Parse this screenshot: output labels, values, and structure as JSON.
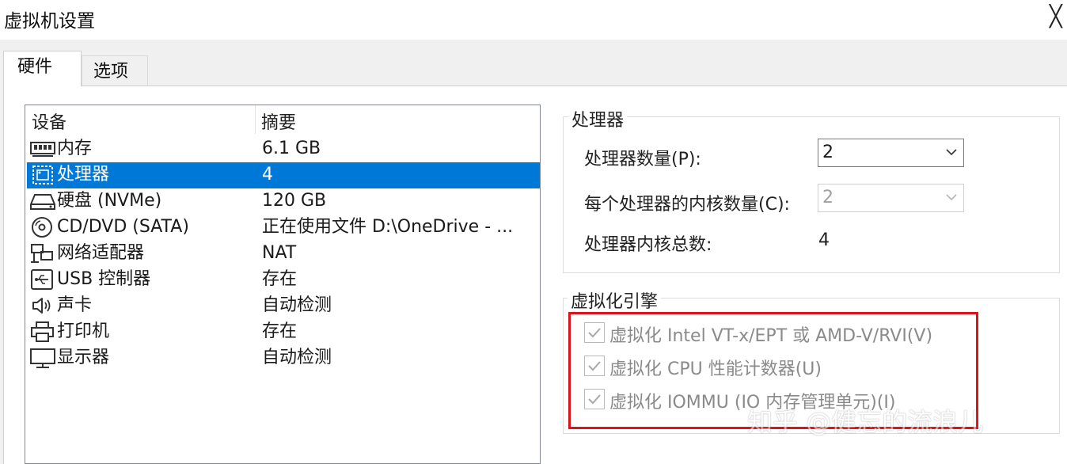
{
  "window": {
    "title": "虚拟机设置",
    "close_glyph": "╳"
  },
  "tabs": [
    {
      "label": "硬件",
      "active": true
    },
    {
      "label": "选项",
      "active": false
    }
  ],
  "device_list": {
    "columns": [
      "设备",
      "摘要"
    ],
    "rows": [
      {
        "icon": "memory-icon",
        "name": "内存",
        "summary": "6.1 GB",
        "selected": false
      },
      {
        "icon": "processor-icon",
        "name": "处理器",
        "summary": "4",
        "selected": true
      },
      {
        "icon": "hard-disk-icon",
        "name": "硬盘 (NVMe)",
        "summary": "120 GB",
        "selected": false
      },
      {
        "icon": "cd-dvd-icon",
        "name": "CD/DVD (SATA)",
        "summary": "正在使用文件 D:\\OneDrive - ...",
        "selected": false
      },
      {
        "icon": "network-adapter-icon",
        "name": "网络适配器",
        "summary": "NAT",
        "selected": false
      },
      {
        "icon": "usb-icon",
        "name": "USB 控制器",
        "summary": "存在",
        "selected": false
      },
      {
        "icon": "sound-icon",
        "name": "声卡",
        "summary": "自动检测",
        "selected": false
      },
      {
        "icon": "printer-icon",
        "name": "打印机",
        "summary": "存在",
        "selected": false
      },
      {
        "icon": "display-icon",
        "name": "显示器",
        "summary": "自动检测",
        "selected": false
      }
    ]
  },
  "processor_group": {
    "title": "处理器",
    "processor_count_label": "处理器数量(P):",
    "processor_count_value": "2",
    "cores_per_processor_label": "每个处理器的内核数量(C):",
    "cores_per_processor_value": "2",
    "total_cores_label": "处理器内核总数:",
    "total_cores_value": "4"
  },
  "virtualization_group": {
    "title": "虚拟化引擎",
    "options": [
      {
        "label": "虚拟化 Intel VT-x/EPT 或 AMD-V/RVI(V)",
        "checked": true,
        "enabled": false
      },
      {
        "label": "虚拟化 CPU 性能计数器(U)",
        "checked": true,
        "enabled": false
      },
      {
        "label": "虚拟化 IOMMU (IO 内存管理单元)(I)",
        "checked": true,
        "enabled": false
      }
    ]
  },
  "watermark": "知乎 @健忘的流浪儿",
  "colors": {
    "selection": "#0078d7",
    "highlight_box": "#d9141c",
    "disabled_text": "#8a8a8a"
  }
}
